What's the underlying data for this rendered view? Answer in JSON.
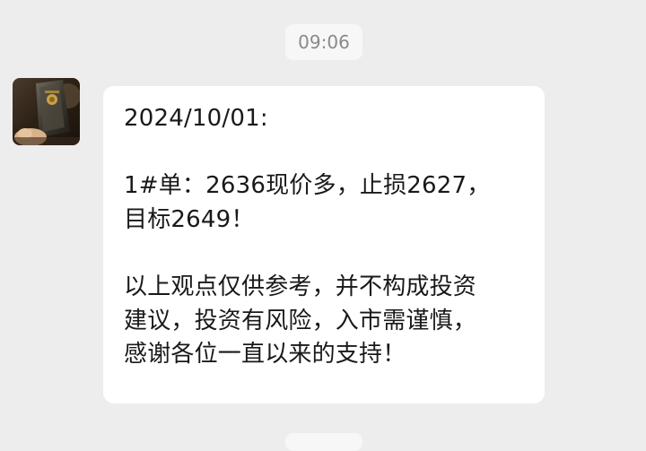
{
  "timestamp": "09:06",
  "message": {
    "sender_avatar": "avatar-icon",
    "text": "2024/10/01:\n\n1#单：2636现价多，止损2627，\n目标2649！\n\n以上观点仅供参考，并不构成投资\n建议，投资有风险，入市需谨慎，\n感谢各位一直以来的支持！"
  },
  "colors": {
    "background": "#ededed",
    "bubble": "#ffffff",
    "timestamp_bg": "#f7f7f7",
    "timestamp_text": "#8a8a8a",
    "message_text": "#191919"
  }
}
